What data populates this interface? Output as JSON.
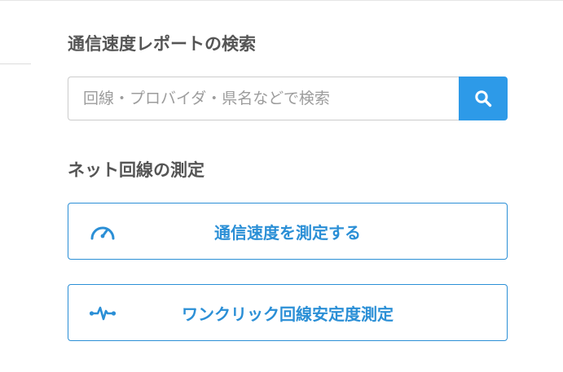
{
  "search": {
    "heading": "通信速度レポートの検索",
    "placeholder": "回線・プロバイダ・県名などで検索",
    "value": "",
    "button_icon": "search-icon"
  },
  "measure": {
    "heading": "ネット回線の測定",
    "buttons": [
      {
        "label": "通信速度を測定する",
        "icon": "speedometer-icon"
      },
      {
        "label": "ワンクリック回線安定度測定",
        "icon": "pulse-icon"
      }
    ]
  },
  "colors": {
    "accent": "#2d9ae8",
    "button_border": "#2b8fd6",
    "heading_text": "#555555",
    "placeholder_text": "#9c9c9c"
  }
}
